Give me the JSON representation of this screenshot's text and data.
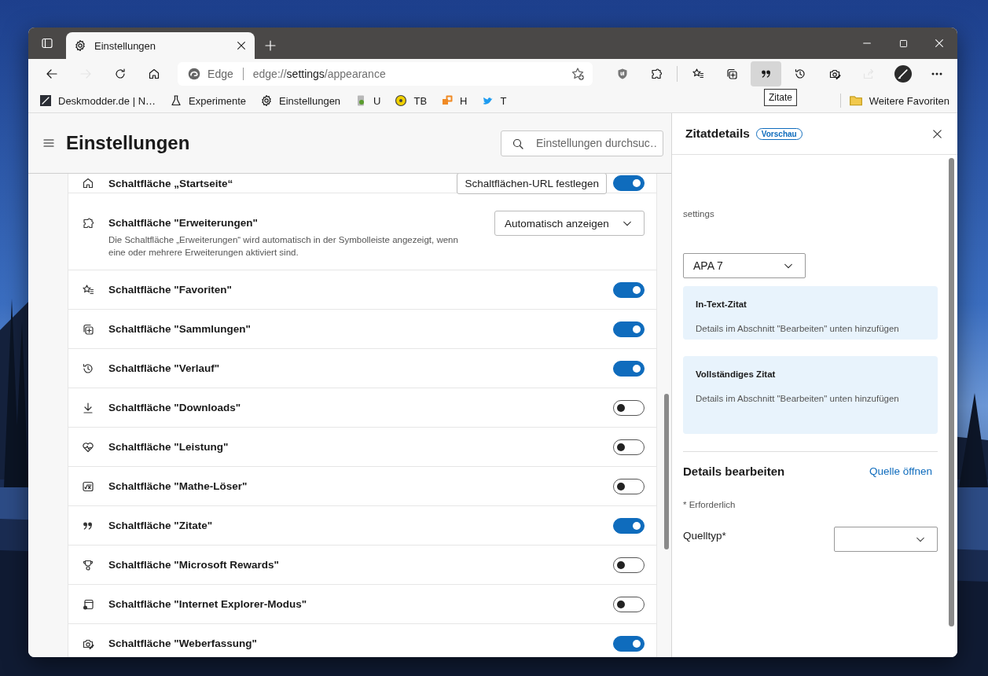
{
  "window": {
    "tab": {
      "title": "Einstellungen"
    }
  },
  "toolbar": {
    "nav_buttons": [
      {
        "disabled": false
      },
      {
        "disabled": true
      },
      {
        "disabled": false
      },
      {
        "disabled": false
      }
    ],
    "address": {
      "site": "Edge",
      "url": "edge://**settings**/appearance"
    },
    "buttons": [
      {
        "selected": false,
        "disabled": false
      },
      {
        "selected": false,
        "disabled": false
      },
      {
        "selected": false,
        "disabled": false
      },
      {
        "selected": false,
        "disabled": false
      },
      {
        "selected": true,
        "disabled": false
      },
      {
        "selected": false,
        "disabled": false
      },
      {
        "selected": false,
        "disabled": false
      },
      {
        "selected": false,
        "disabled": true
      },
      {
        "selected": false,
        "disabled": false
      },
      {
        "selected": false,
        "disabled": false
      }
    ],
    "tooltip": "Zitate"
  },
  "favorites_bar": {
    "items": [
      {
        "label": "Deskmodder.de | N…"
      },
      {
        "label": "Experimente"
      },
      {
        "label": "Einstellungen"
      },
      {
        "label": "U"
      },
      {
        "label": "TB"
      },
      {
        "label": "H"
      },
      {
        "label": "T"
      }
    ],
    "other": "Weitere Favoriten"
  },
  "settings": {
    "title": "Einstellungen",
    "search_placeholder": "Einstellungen durchsuc…",
    "rows": [
      {
        "label": "Schaltfläche „Startseite“",
        "button": "Schaltflächen-URL festlegen",
        "on": true
      },
      {
        "label": "Schaltfläche \"Erweiterungen\"",
        "description": "Die Schaltfläche „Erweiterungen“ wird automatisch in der Symbolleiste angezeigt, wenn eine oder mehrere Erweiterungen aktiviert sind.",
        "dropdown": "Automatisch anzeigen"
      },
      {
        "label": "Schaltfläche \"Favoriten\"",
        "on": true
      },
      {
        "label": "Schaltfläche \"Sammlungen\"",
        "on": true
      },
      {
        "label": "Schaltfläche \"Verlauf\"",
        "on": true
      },
      {
        "label": "Schaltfläche \"Downloads\"",
        "on": false
      },
      {
        "label": "Schaltfläche \"Leistung\"",
        "on": false
      },
      {
        "label": "Schaltfläche \"Mathe-Löser\"",
        "on": false
      },
      {
        "label": " Schaltfläche \"Zitate\"",
        "on": true
      },
      {
        "label": "Schaltfläche \"Microsoft Rewards\"",
        "on": false
      },
      {
        "label": "Schaltfläche \"Internet Explorer-Modus\"",
        "on": false
      },
      {
        "label": "Schaltfläche \"Weberfassung\"",
        "on": true
      }
    ]
  },
  "citation_panel": {
    "title": "Zitatdetails",
    "badge": "Vorschau",
    "source": "settings",
    "style": "APA 7",
    "cards": [
      {
        "title": "In-Text-Zitat",
        "text": "Details im Abschnitt \"Bearbeiten\" unten hinzufügen"
      },
      {
        "title": "Vollständiges Zitat",
        "text": "Details im Abschnitt \"Bearbeiten\" unten hinzufügen"
      }
    ],
    "edit_title": "Details bearbeiten",
    "link": "Quelle öffnen",
    "required_note": "* Erforderlich",
    "fields": [
      {
        "label": "Quelltyp*"
      }
    ]
  }
}
